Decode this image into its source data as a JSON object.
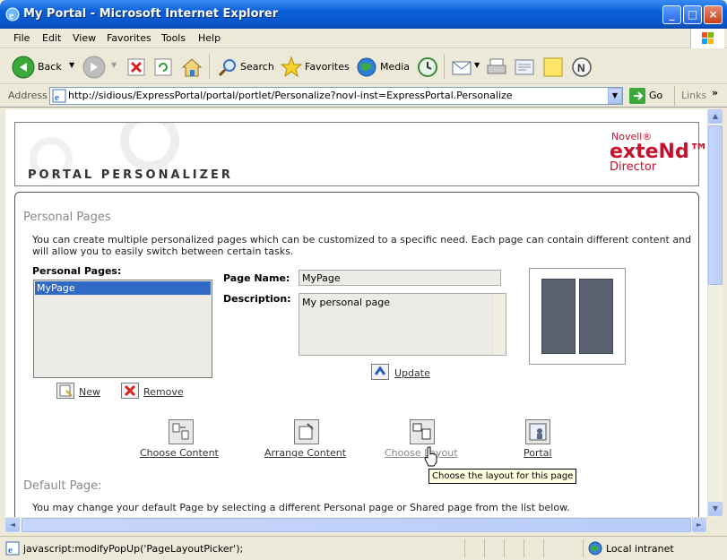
{
  "window": {
    "title": "My Portal - Microsoft Internet Explorer",
    "minimize": "_",
    "maximize": "□",
    "close": "×"
  },
  "menu": [
    "File",
    "Edit",
    "View",
    "Favorites",
    "Tools",
    "Help"
  ],
  "toolbar": {
    "back": "Back",
    "search": "Search",
    "favorites": "Favorites",
    "media": "Media"
  },
  "address": {
    "label": "Address",
    "url": "http://sidious/ExpressPortal/portal/portlet/Personalize?novl-inst=ExpressPortal.Personalize",
    "go": "Go",
    "links": "Links"
  },
  "banner": {
    "title": "PORTAL PERSONALIZER",
    "brand_top": "Novell®",
    "brand_main": "exteNd™",
    "brand_sub": "Director"
  },
  "personal_pages": {
    "heading": "Personal Pages",
    "intro": "You can create multiple personalized pages which can be customized to a specific need. Each page can contain different content and will allow you to easily switch between certain tasks.",
    "list_label": "Personal Pages:",
    "items": [
      "MyPage"
    ],
    "page_name_label": "Page Name:",
    "page_name_value": "MyPage",
    "description_label": "Description:",
    "description_value": "My personal page",
    "update": "Update",
    "new": "New",
    "remove": "Remove"
  },
  "actions": [
    {
      "label": "Choose Content"
    },
    {
      "label": "Arrange Content"
    },
    {
      "label": "Choose Layout"
    },
    {
      "label": "Portal"
    }
  ],
  "tooltip": "Choose the layout for this page",
  "default_page": {
    "heading": "Default Page:",
    "text": "You may change your default Page by selecting a different Personal page or Shared page from the list below."
  },
  "status": {
    "text": "javascript:modifyPopUp('PageLayoutPicker');",
    "zone": "Local intranet"
  },
  "colors": {
    "titlebar": "#0b55c9",
    "brand": "#c8102e",
    "selection": "#316ac5",
    "layout_column": "#5a6272"
  }
}
